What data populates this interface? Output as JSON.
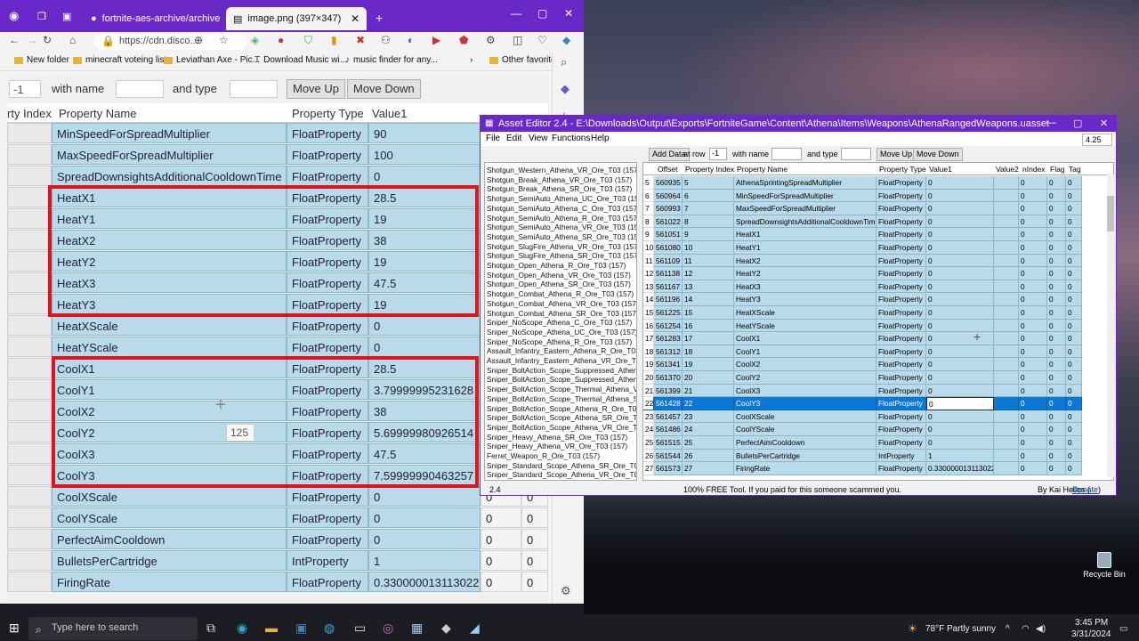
{
  "browser": {
    "tabs": [
      {
        "label": "fortnite-aes-archive/archive at m"
      },
      {
        "label": "image.png (397×347)"
      }
    ],
    "address": "https://cdn.disco...",
    "favorites": [
      "New folder",
      "minecraft voteing list",
      "Leviathan Axe - Pic...",
      "Download Music wi...",
      "music finder for any...",
      "Other favorites"
    ]
  },
  "zoomed": {
    "filter_value": "-1",
    "with_name_label": "with name",
    "and_type_label": "and type",
    "move_up": "Move Up",
    "move_down": "Move Down",
    "headers": [
      "rty Index",
      "Property Name",
      "Property Type",
      "Value1",
      "Value2",
      "nIndex"
    ],
    "rows": [
      {
        "name": "MinSpeedForSpreadMultiplier",
        "type": "FloatProperty",
        "value": "90"
      },
      {
        "name": "MaxSpeedForSpreadMultiplier",
        "type": "FloatProperty",
        "value": "100"
      },
      {
        "name": "SpreadDownsightsAdditionalCooldownTime",
        "type": "FloatProperty",
        "value": "0"
      },
      {
        "name": "HeatX1",
        "type": "FloatProperty",
        "value": "28.5"
      },
      {
        "name": "HeatY1",
        "type": "FloatProperty",
        "value": "19"
      },
      {
        "name": "HeatX2",
        "type": "FloatProperty",
        "value": "38"
      },
      {
        "name": "HeatY2",
        "type": "FloatProperty",
        "value": "19"
      },
      {
        "name": "HeatX3",
        "type": "FloatProperty",
        "value": "47.5"
      },
      {
        "name": "HeatY3",
        "type": "FloatProperty",
        "value": "19"
      },
      {
        "name": "HeatXScale",
        "type": "FloatProperty",
        "value": "0"
      },
      {
        "name": "HeatYScale",
        "type": "FloatProperty",
        "value": "0"
      },
      {
        "name": "CoolX1",
        "type": "FloatProperty",
        "value": "28.5"
      },
      {
        "name": "CoolY1",
        "type": "FloatProperty",
        "value": "3.79999995231628"
      },
      {
        "name": "CoolX2",
        "type": "FloatProperty",
        "value": "38"
      },
      {
        "name": "CoolY2",
        "type": "FloatProperty",
        "value": "5.69999980926514"
      },
      {
        "name": "CoolX3",
        "type": "FloatProperty",
        "value": "47.5"
      },
      {
        "name": "CoolY3",
        "type": "FloatProperty",
        "value": "7.59999990463257"
      },
      {
        "name": "CoolXScale",
        "type": "FloatProperty",
        "value": "0"
      },
      {
        "name": "CoolYScale",
        "type": "FloatProperty",
        "value": "0"
      },
      {
        "name": "PerfectAimCooldown",
        "type": "FloatProperty",
        "value": "0"
      },
      {
        "name": "BulletsPerCartridge",
        "type": "IntProperty",
        "value": "1"
      },
      {
        "name": "FiringRate",
        "type": "FloatProperty",
        "value": "0.330000013113022"
      }
    ],
    "extra_zero": "0",
    "tooltip": "125"
  },
  "asset_editor": {
    "title": "Asset Editor 2.4 - E:\\Downloads\\Output\\Exports\\FortniteGame\\Content\\Athena\\Items\\Weapons\\AthenaRangedWeapons.uasset",
    "menu": [
      "File",
      "Edit",
      "View",
      "Functions",
      "Help"
    ],
    "version_select": "4.25",
    "add_data": "Add Data",
    "at_row_label": "at row",
    "at_row_value": "-1",
    "with_name_label": "with name",
    "and_type_label": "and type",
    "move_up": "Move Up",
    "move_down": "Move Down",
    "list": [
      "Shotgun_Western_Athena_VR_Ore_T03 (157)",
      "Shotgun_Break_Athena_VR_Ore_T03 (157)",
      "Shotgun_Break_Athena_SR_Ore_T03 (157)",
      "Shotgun_SemiAuto_Athena_UC_Ore_T03 (157)",
      "Shotgun_SemiAuto_Athena_C_Ore_T03 (157)",
      "Shotgun_SemiAuto_Athena_R_Ore_T03 (157)",
      "Shotgun_SemiAuto_Athena_VR_Ore_T03 (157)",
      "Shotgun_SemiAuto_Athena_SR_Ore_T03 (157)",
      "Shotgun_SlugFire_Athena_VR_Ore_T03 (157)",
      "Shotgun_SlugFire_Athena_SR_Ore_T03 (157)",
      "Shotgun_Open_Athena_R_Ore_T03 (157)",
      "Shotgun_Open_Athena_VR_Ore_T03 (157)",
      "Shotgun_Open_Athena_SR_Ore_T03 (157)",
      "Shotgun_Combat_Athena_R_Ore_T03 (157)",
      "Shotgun_Combat_Athena_VR_Ore_T03 (157)",
      "Shotgun_Combat_Athena_SR_Ore_T03 (157)",
      "Sniper_NoScope_Athena_C_Ore_T03 (157)",
      "Sniper_NoScope_Athena_UC_Ore_T03 (157)",
      "Sniper_NoScope_Athena_R_Ore_T03 (157)",
      "Assault_Infantry_Eastern_Athena_R_Ore_T03",
      "Assault_Infantry_Eastern_Athena_VR_Ore_T03",
      "Sniper_BoltAction_Scope_Suppressed_Athena",
      "Sniper_BoltAction_Scope_Suppressed_Athena",
      "Sniper_BoltAction_Scope_Thermal_Athena_VR",
      "Sniper_BoltAction_Scope_Thermal_Athena_SR",
      "Sniper_BoltAction_Scope_Athena_R_Ore_T03",
      "Sniper_BoltAction_Scope_Athena_SR_Ore_T03",
      "Sniper_BoltAction_Scope_Athena_VR_Ore_T03",
      "Sniper_Heavy_Athena_SR_Ore_T03 (157)",
      "Sniper_Heavy_Athena_VR_Ore_T03 (157)",
      "Ferret_Weapon_R_Ore_T03 (157)",
      "Sniper_Standard_Scope_Athena_SR_Ore_T03",
      "Sniper_Standard_Scope_Athena_VR_Ore_T03"
    ],
    "grid_headers": [
      "Offset",
      "Property Index",
      "Property Name",
      "Property Type",
      "Value1",
      "Value2",
      "nIndex",
      "Flag",
      "Tag"
    ],
    "grid_rows": [
      [
        "5",
        "560935",
        "5",
        "AthenaSprintingSpreadMultiplier",
        "FloatProperty",
        "0",
        "",
        "0",
        "0",
        "0"
      ],
      [
        "6",
        "560964",
        "6",
        "MinSpeedForSpreadMultiplier",
        "FloatProperty",
        "0",
        "",
        "0",
        "0",
        "0"
      ],
      [
        "7",
        "560993",
        "7",
        "MaxSpeedForSpreadMultiplier",
        "FloatProperty",
        "0",
        "",
        "0",
        "0",
        "0"
      ],
      [
        "8",
        "561022",
        "8",
        "SpreadDownsightsAdditionalCooldownTime",
        "FloatProperty",
        "0",
        "",
        "0",
        "0",
        "0"
      ],
      [
        "9",
        "561051",
        "9",
        "HeatX1",
        "FloatProperty",
        "0",
        "",
        "0",
        "0",
        "0"
      ],
      [
        "10",
        "561080",
        "10",
        "HeatY1",
        "FloatProperty",
        "0",
        "",
        "0",
        "0",
        "0"
      ],
      [
        "11",
        "561109",
        "11",
        "HeatX2",
        "FloatProperty",
        "0",
        "",
        "0",
        "0",
        "0"
      ],
      [
        "12",
        "561138",
        "12",
        "HeatY2",
        "FloatProperty",
        "0",
        "",
        "0",
        "0",
        "0"
      ],
      [
        "13",
        "561167",
        "13",
        "HeatX3",
        "FloatProperty",
        "0",
        "",
        "0",
        "0",
        "0"
      ],
      [
        "14",
        "561196",
        "14",
        "HeatY3",
        "FloatProperty",
        "0",
        "",
        "0",
        "0",
        "0"
      ],
      [
        "15",
        "561225",
        "15",
        "HeatXScale",
        "FloatProperty",
        "0",
        "",
        "0",
        "0",
        "0"
      ],
      [
        "16",
        "561254",
        "16",
        "HeatYScale",
        "FloatProperty",
        "0",
        "",
        "0",
        "0",
        "0"
      ],
      [
        "17",
        "561283",
        "17",
        "CoolX1",
        "FloatProperty",
        "0",
        "",
        "0",
        "0",
        "0"
      ],
      [
        "18",
        "561312",
        "18",
        "CoolY1",
        "FloatProperty",
        "0",
        "",
        "0",
        "0",
        "0"
      ],
      [
        "19",
        "561341",
        "19",
        "CoolX2",
        "FloatProperty",
        "0",
        "",
        "0",
        "0",
        "0"
      ],
      [
        "20",
        "561370",
        "20",
        "CoolY2",
        "FloatProperty",
        "0",
        "",
        "0",
        "0",
        "0"
      ],
      [
        "21",
        "561399",
        "21",
        "CoolX3",
        "FloatProperty",
        "0",
        "",
        "0",
        "0",
        "0"
      ],
      [
        "22",
        "561428",
        "22",
        "CoolY3",
        "FloatProperty",
        "0",
        "",
        "0",
        "0",
        "0"
      ],
      [
        "23",
        "561457",
        "23",
        "CoolXScale",
        "FloatProperty",
        "0",
        "",
        "0",
        "0",
        "0"
      ],
      [
        "24",
        "561486",
        "24",
        "CoolYScale",
        "FloatProperty",
        "0",
        "",
        "0",
        "0",
        "0"
      ],
      [
        "25",
        "561515",
        "25",
        "PerfectAimCooldown",
        "FloatProperty",
        "0",
        "",
        "0",
        "0",
        "0"
      ],
      [
        "26",
        "561544",
        "26",
        "BulletsPerCartridge",
        "IntProperty",
        "1",
        "",
        "0",
        "0",
        "0"
      ],
      [
        "27",
        "561573",
        "27",
        "FiringRate",
        "FloatProperty",
        "0.330000013113022",
        "",
        "0",
        "0",
        "0"
      ]
    ],
    "selected_row": 17,
    "status_version": "2.4",
    "status_text": "100% FREE Tool. If you paid for this someone scammed you.",
    "status_by": "By Kai Heilos (",
    "status_donate": "Donate",
    "status_close": ")"
  },
  "taskbar": {
    "search_placeholder": "Type here to search",
    "weather": "78°F  Partly sunny",
    "time": "3:45 PM",
    "date": "3/31/2024",
    "recycle_bin": "Recycle Bin"
  },
  "colors": {
    "browser_purple": "#6a28c8",
    "cell_blue": "#b9dae9",
    "highlight_red": "#e0141e",
    "selection_blue": "#0a78d7"
  }
}
